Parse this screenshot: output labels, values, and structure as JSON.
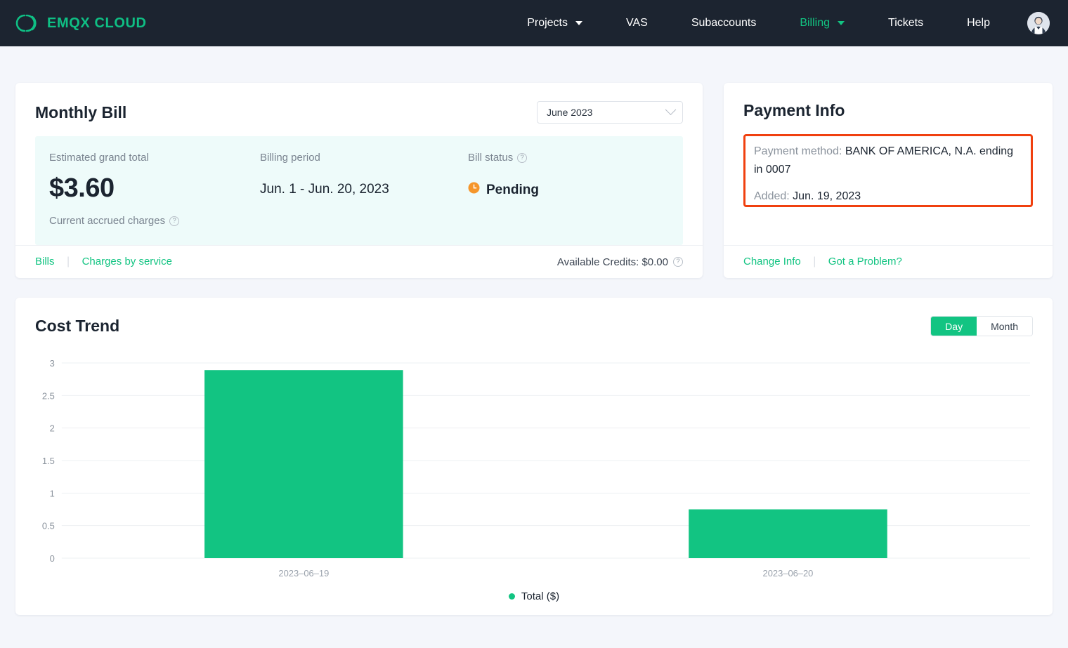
{
  "brand": {
    "name": "EMQX CLOUD",
    "logo_icon": "emqx-logo-icon",
    "accent": "#0fbf84"
  },
  "nav": {
    "items": [
      {
        "label": "Projects",
        "has_caret": true,
        "active": false
      },
      {
        "label": "VAS",
        "has_caret": false,
        "active": false
      },
      {
        "label": "Subaccounts",
        "has_caret": false,
        "active": false
      },
      {
        "label": "Billing",
        "has_caret": true,
        "active": true
      },
      {
        "label": "Tickets",
        "has_caret": false,
        "active": false
      },
      {
        "label": "Help",
        "has_caret": false,
        "active": false
      }
    ],
    "avatar_icon": "user-avatar-icon"
  },
  "monthly_bill": {
    "title": "Monthly Bill",
    "month_select": {
      "value": "June  2023",
      "chevron_icon": "chevron-down-icon"
    },
    "estimated": {
      "label": "Estimated grand total",
      "amount": "$3.60",
      "sub_label": "Current accrued charges",
      "help_icon": "question-mark-icon"
    },
    "period": {
      "label": "Billing period",
      "value": "Jun. 1 - Jun. 20, 2023"
    },
    "status": {
      "label": "Bill status",
      "help_icon": "question-mark-icon",
      "value": "Pending",
      "status_icon": "clock-icon",
      "status_color": "#f5962b"
    },
    "footer": {
      "bills_link": "Bills",
      "charges_link": "Charges by service",
      "credits_text": "Available Credits: $0.00",
      "credits_help_icon": "question-mark-icon"
    }
  },
  "payment_info": {
    "title": "Payment Info",
    "highlight_color": "#f0400f",
    "method_key": "Payment method:",
    "method_value": "BANK OF AMERICA, N.A. ending",
    "method_value_line2": "in 0007",
    "added_key": "Added:",
    "added_value": "Jun. 19, 2023",
    "change_link": "Change Info",
    "problem_link": "Got a Problem?"
  },
  "cost_trend": {
    "title": "Cost Trend",
    "toggle": {
      "day": "Day",
      "month": "Month",
      "selected": "Day"
    }
  },
  "chart_data": {
    "type": "bar",
    "title": "Cost Trend",
    "categories": [
      "2023-06-19",
      "2023-06-20"
    ],
    "series": [
      {
        "name": "Total ($)",
        "values": [
          2.89,
          0.75
        ],
        "color": "#12c482"
      }
    ],
    "xlabel": "",
    "ylabel": "",
    "ylim": [
      0,
      3
    ],
    "yticks": [
      0,
      0.5,
      1,
      1.5,
      2,
      2.5,
      3
    ],
    "ytick_labels": [
      "0",
      "0.5",
      "1",
      "1.5",
      "2",
      "2.5",
      "3"
    ],
    "grid": true,
    "legend": [
      "Total ($)"
    ],
    "legend_position": "bottom"
  }
}
